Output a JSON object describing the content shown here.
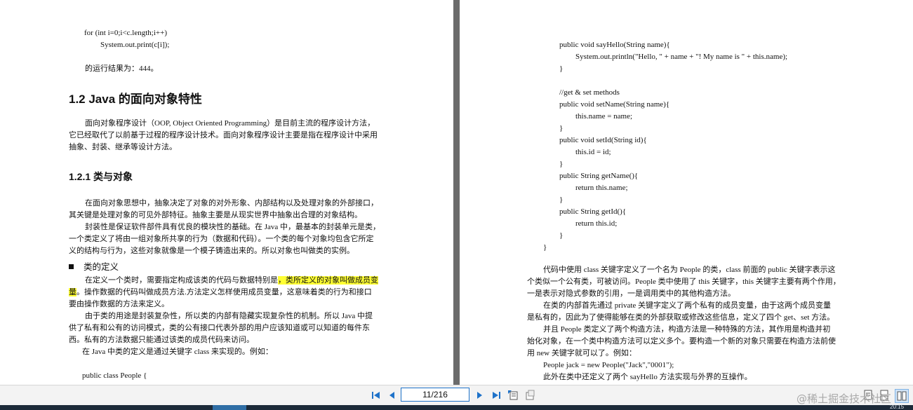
{
  "left_page": {
    "code_for": "for (int i=0;i<c.length;i++)",
    "code_print": "System.out.print(c[i]);",
    "result": "的运行结果为：444。",
    "section_title": "1.2 Java 的面向对象特性",
    "oop_para": [
      "面向对象程序设计（OOP, Object Oriented Programming）是目前主流的程序设计方法，",
      "它已经取代了以前基于过程的程序设计技术。面向对象程序设计主要是指在程序设计中采用",
      "抽象、封装、继承等设计方法。"
    ],
    "subsection_title": "1.2.1  类与对象",
    "abstract_para": [
      "在面向对象思想中，抽象决定了对象的对外形象、内部结构以及处理对象的外部接口，",
      "其关键是处理对象的可见外部特征。抽象主要是从现实世界中抽象出合理的对象结构。"
    ],
    "encap_para": [
      "封装性是保证软件部件具有优良的模块性的基础。在 Java 中，最基本的封装单元是类，",
      "一个类定义了将由一组对象所共享的行为（数据和代码）。一个类的每个对象均包含它所定",
      "义的结构与行为，这些对象就像是一个模子铸造出来的。所以对象也叫做类的实例。"
    ],
    "bullet_title": "类的定义",
    "def_line1_a": "在定义一个类时，需要指定构成该类的代码与数据特别是",
    "def_line1_hl": "，类所定义的对象叫做成员变",
    "def_line2_hl": "量",
    "def_line2_b": "。操作数据的代码叫做成员方法.方法定义怎样使用成员变量，这意味着类的行为和接口",
    "def_line3": "要由操作数据的方法来定义。",
    "purpose_para": [
      "由于类的用途是封装复杂性，所以类的内部有隐藏实现复杂性的机制。所以 Java 中提",
      "供了私有和公有的访问模式，类的公有接口代表外部的用户应该知道或可以知道的每件东",
      "西。私有的方法数据只能通过该类的成员代码来访问。"
    ],
    "keyword_para": "在 Java 中类的定义是通过关键字 class 来实现的。例如：",
    "code_class": "public class People {"
  },
  "right_page": {
    "code_lines": [
      "public void sayHello(String name){",
      "System.out.println(\"Hello, \" + name + \"! My name is \" + this.name);",
      "}",
      "//get & set methods",
      "public void setName(String name){",
      "this.name = name;",
      "}",
      "public void setId(String id){",
      "this.id = id;",
      "}",
      "public String getName(){",
      "return this.name;",
      "}",
      "public String getId(){",
      "return this.id;",
      "}",
      "}"
    ],
    "body_lines": [
      "代码中使用 class 关键字定义了一个名为 People 的类，class 前面的 public 关键字表示这",
      "个类似一个公有类，可被访问。People 类中使用了 this 关键字，this 关键字主要有两个作用，",
      "一是表示对隐式参数的引用，一是调用类中的其他构造方法。",
      "在类的内部首先通过 private 关键字定义了两个私有的成员变量，由于这两个成员变量",
      "是私有的，因此为了使得能够在类的外部获取或修改这些信息，定义了四个 get、set 方法。",
      "并且 People 类定义了两个构造方法，构造方法是一种特殊的方法，其作用是构造并初",
      "始化对象，在一个类中构造方法可以定义多个。要构造一个新的对象只需要在构造方法前使",
      "用 new 关键字就可以了。例如：",
      "People jack = new People(\"Jack\",\"0001\");",
      "此外在类中还定义了两个 sayHello 方法实现与外界的互操作。"
    ]
  },
  "toolbar": {
    "page_indicator": "11/216",
    "watermark": "@稀土掘金技术社区",
    "icons": [
      "first-page-icon",
      "prev-page-icon",
      "next-page-icon",
      "last-page-icon",
      "fit-page-icon",
      "rotate-icon",
      "single-page-icon",
      "continuous-page-icon",
      "two-page-icon"
    ]
  },
  "taskbar": {
    "clock": "20:15"
  },
  "colors": {
    "highlight": "#ffff33",
    "nav_blue": "#1e72c9",
    "gutter": "#6b6b6b"
  }
}
